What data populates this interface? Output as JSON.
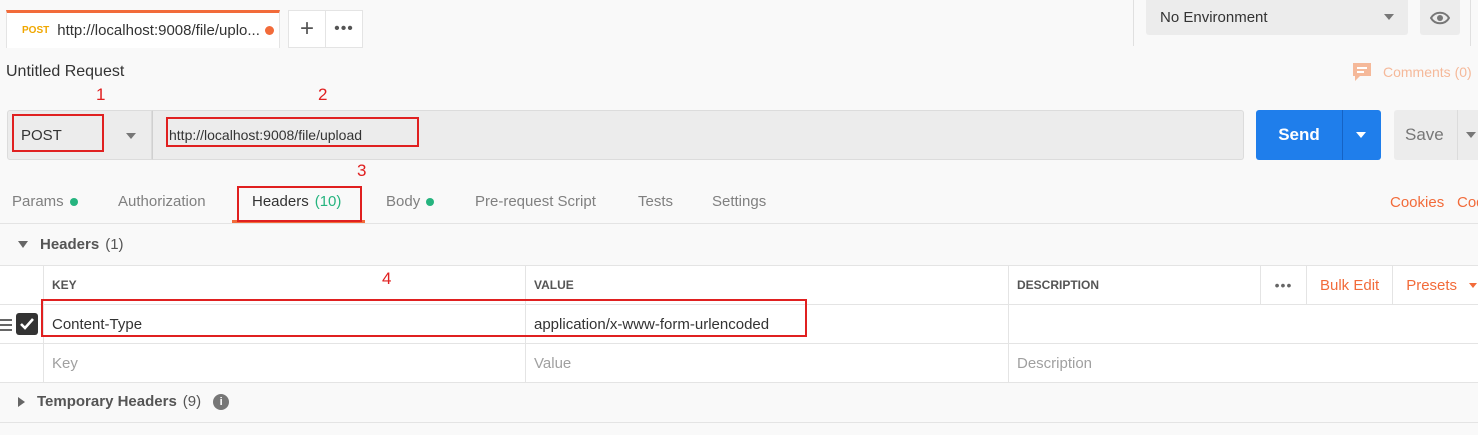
{
  "tab": {
    "method": "POST",
    "title": "http://localhost:9008/file/uplo..."
  },
  "tab_actions": {
    "add": "+",
    "more": "•••"
  },
  "environment": {
    "selected": "No Environment"
  },
  "request": {
    "title": "Untitled Request",
    "comments": "Comments (0)",
    "method": "POST",
    "url": "http://localhost:9008/file/upload"
  },
  "buttons": {
    "send": "Send",
    "save": "Save"
  },
  "annotations": [
    "1",
    "2",
    "3",
    "4"
  ],
  "subtabs": [
    {
      "label": "Params"
    },
    {
      "label": "Authorization"
    },
    {
      "label": "Headers",
      "count": "(10)"
    },
    {
      "label": "Body"
    },
    {
      "label": "Pre-request Script"
    },
    {
      "label": "Tests"
    },
    {
      "label": "Settings"
    }
  ],
  "right_links": {
    "cookies": "Cookies",
    "code": "Code"
  },
  "headers_section": {
    "title": "Headers",
    "count": "(1)",
    "columns": {
      "key": "KEY",
      "value": "VALUE",
      "description": "DESCRIPTION"
    },
    "more": "•••",
    "bulk_edit": "Bulk Edit",
    "presets": "Presets",
    "rows": [
      {
        "key": "Content-Type",
        "value": "application/x-www-form-urlencoded",
        "description": "",
        "checked": true
      }
    ],
    "placeholders": {
      "key": "Key",
      "value": "Value",
      "description": "Description"
    }
  },
  "temporary_headers": {
    "title": "Temporary Headers",
    "count": "(9)"
  },
  "colors": {
    "accent": "#f26b3a",
    "send_blue": "#1f7eeb",
    "status_green": "#26b47f",
    "annotation_red": "#e02020",
    "method_orange": "#f0a700"
  }
}
